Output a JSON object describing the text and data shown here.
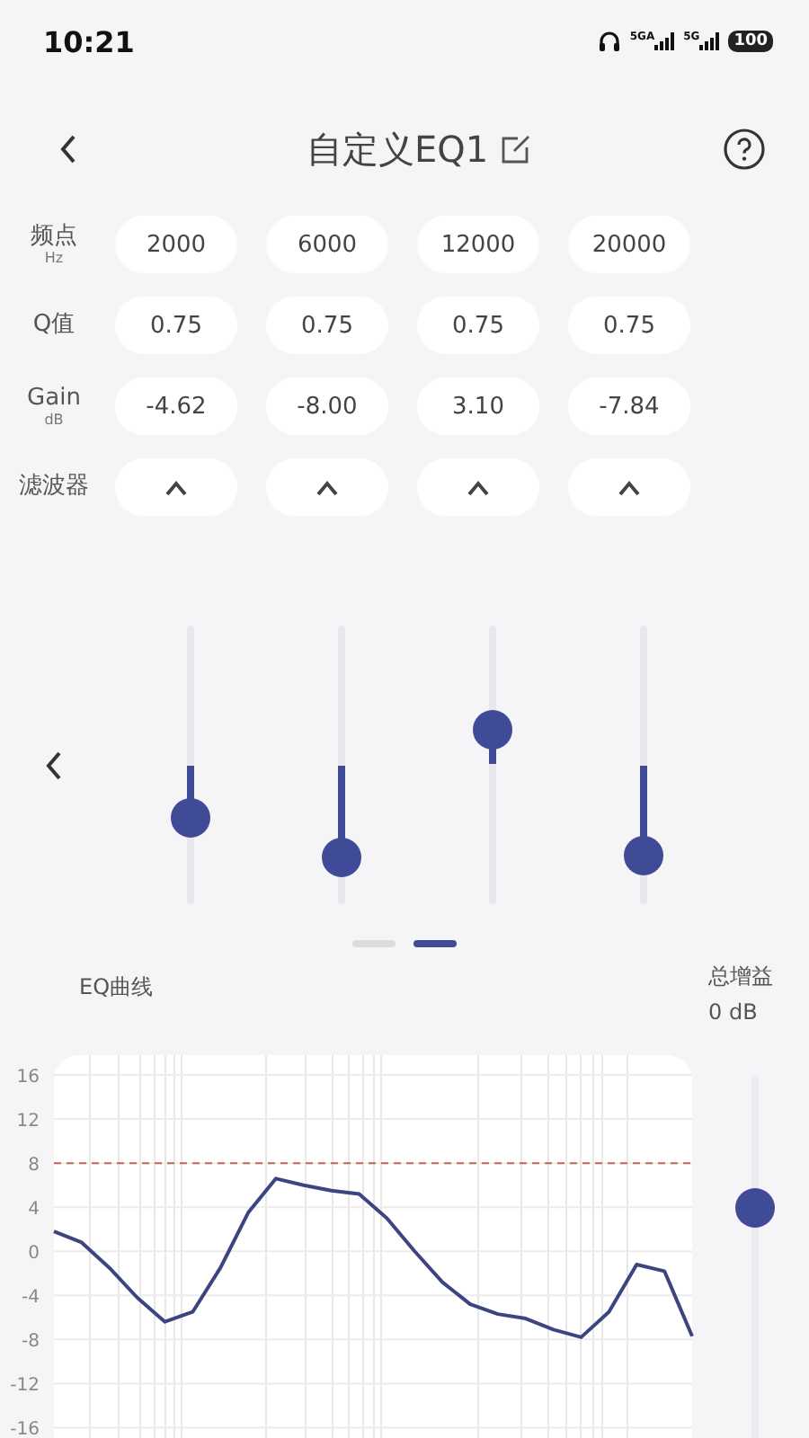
{
  "status_bar": {
    "time": "10:21",
    "network_1": "5GA",
    "network_2": "5G",
    "battery": "100"
  },
  "header": {
    "title": "自定义EQ1"
  },
  "param_rows": [
    {
      "label": "频点",
      "unit": "Hz",
      "kind": "text",
      "values": [
        "2000",
        "6000",
        "12000",
        "20000"
      ]
    },
    {
      "label": "Q值",
      "kind": "text",
      "values": [
        "0.75",
        "0.75",
        "0.75",
        "0.75"
      ]
    },
    {
      "label": "Gain",
      "unit": "dB",
      "kind": "text",
      "values": [
        "-4.62",
        "-8.00",
        "3.10",
        "-7.84"
      ]
    },
    {
      "label": "滤波器",
      "kind": "filter",
      "filters": [
        {
          "kind": "peak"
        },
        {
          "kind": "peak"
        },
        {
          "kind": "peak"
        },
        {
          "kind": "peak"
        }
      ]
    }
  ],
  "bands": [
    {
      "level": 0.3075
    },
    {
      "level": 0.1667
    },
    {
      "level": 0.629
    },
    {
      "level": 0.173
    }
  ],
  "pager": [
    {
      "selected": false
    },
    {
      "selected": true
    }
  ],
  "eq_curve": {
    "title": "EQ曲线",
    "chart_data": {
      "type": "line",
      "categories": [
        null,
        null,
        null,
        null,
        null,
        null,
        null,
        null,
        null,
        null,
        null,
        null,
        null,
        null,
        null,
        null,
        null,
        null,
        null,
        null,
        null,
        null,
        null,
        null
      ],
      "ylim": [
        -18.9,
        17.8
      ],
      "yticks": [
        16,
        12,
        8,
        4,
        0,
        -4,
        -8,
        -12,
        -16
      ],
      "series": [
        {
          "color": "#c0645a",
          "line_style": "dashed",
          "values": [
            8,
            8,
            8,
            8,
            8,
            8,
            8,
            8,
            8,
            8,
            8,
            8,
            8,
            8,
            8,
            8,
            8,
            8,
            8,
            8,
            8,
            8,
            8,
            8
          ]
        },
        {
          "color": "#3d4580",
          "values": [
            1.8,
            0.8,
            -1.5,
            -4.2,
            -6.4,
            -5.5,
            -1.5,
            3.5,
            6.6,
            6.0,
            5.5,
            5.2,
            3,
            0,
            -2.8,
            -4.8,
            -5.7,
            -6.1,
            -7.1,
            -7.8,
            -5.5,
            -1.2,
            -1.8,
            -7.7
          ]
        }
      ],
      "grid": true
    }
  },
  "master_gain": {
    "label": "总增益",
    "reading": "0 dB",
    "level": 0.68
  }
}
